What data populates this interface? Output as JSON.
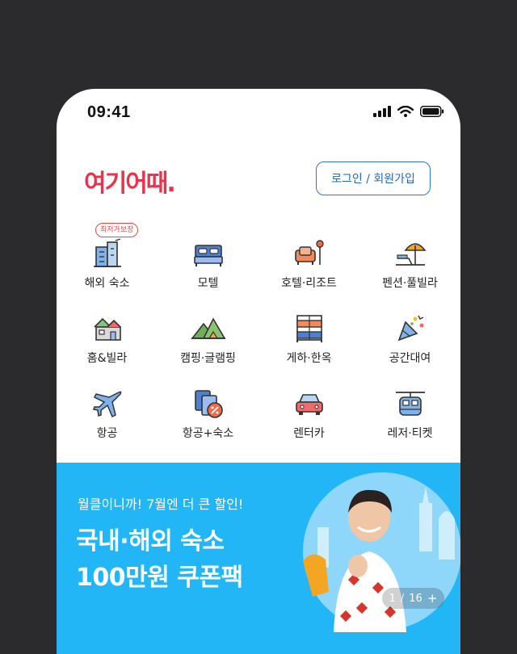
{
  "status_bar": {
    "time": "09:41",
    "icons": [
      "signal-icon",
      "wifi-icon",
      "battery-icon"
    ]
  },
  "header": {
    "logo_text": "여기어때.",
    "login_label": "로그인 / 회원가입"
  },
  "categories": [
    {
      "label": "해외 숙소",
      "icon": "overseas-hotel-icon",
      "badge": "최저가보장"
    },
    {
      "label": "모텔",
      "icon": "bed-icon"
    },
    {
      "label": "호텔·리조트",
      "icon": "sofa-lamp-icon"
    },
    {
      "label": "펜션·풀빌라",
      "icon": "beach-umbrella-icon"
    },
    {
      "label": "홈&빌라",
      "icon": "house-icon"
    },
    {
      "label": "캠핑·글램핑",
      "icon": "tent-mountain-icon"
    },
    {
      "label": "게하·한옥",
      "icon": "bunk-bed-icon"
    },
    {
      "label": "공간대여",
      "icon": "party-popper-icon"
    },
    {
      "label": "항공",
      "icon": "airplane-icon"
    },
    {
      "label": "항공+숙소",
      "icon": "ticket-discount-icon"
    },
    {
      "label": "렌터카",
      "icon": "car-icon"
    },
    {
      "label": "레저·티켓",
      "icon": "cable-car-icon"
    }
  ],
  "banner": {
    "subtitle": "월클이니까! 7월엔 더 큰 할인!",
    "headline_line1": "국내·해외 숙소",
    "headline_line2": "100만원 쿠폰팩",
    "pager_current": "1",
    "pager_total": "16",
    "pager_plus": "+"
  },
  "colors": {
    "brand": "#e9334e",
    "accent_blue": "#2a76d8",
    "banner_bg": "#22b6f6"
  }
}
